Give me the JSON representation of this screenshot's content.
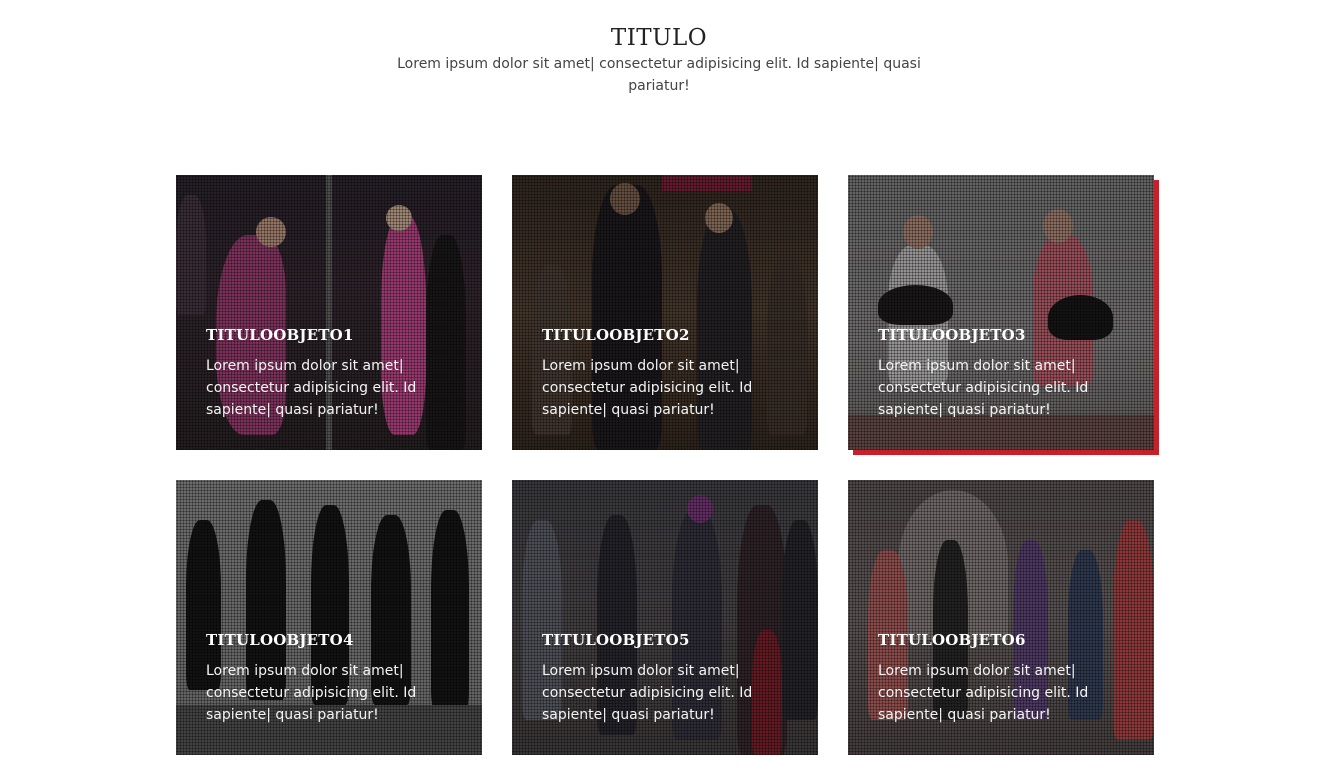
{
  "header": {
    "title": "TITULO",
    "subtitle": "Lorem ipsum dolor sit amet| consectetur adipisicing elit. Id sapiente| quasi pariatur!"
  },
  "cards": [
    {
      "title": "TITULOOBJETO1",
      "desc": "Lorem ipsum dolor sit amet| consectetur adipisicing elit. Id sapiente| quasi pariatur!",
      "image": "ballroom-dance-photo"
    },
    {
      "title": "TITULOOBJETO2",
      "desc": "Lorem ipsum dolor sit amet| consectetur adipisicing elit. Id sapiente| quasi pariatur!",
      "image": "salsa-class-photo"
    },
    {
      "title": "TITULOOBJETO3",
      "desc": "Lorem ipsum dolor sit amet| consectetur adipisicing elit. Id sapiente| quasi pariatur!",
      "image": "jumping-dancers-photo"
    },
    {
      "title": "TITULOOBJETO4",
      "desc": "Lorem ipsum dolor sit amet| consectetur adipisicing elit. Id sapiente| quasi pariatur!",
      "image": "dancer-silhouettes-photo"
    },
    {
      "title": "TITULOOBJETO5",
      "desc": "Lorem ipsum dolor sit amet| consectetur adipisicing elit. Id sapiente| quasi pariatur!",
      "image": "group-dance-class-photo"
    },
    {
      "title": "TITULOOBJETO6",
      "desc": "Lorem ipsum dolor sit amet| consectetur adipisicing elit. Id sapiente| quasi pariatur!",
      "image": "studio-dance-class-photo"
    }
  ],
  "colors": {
    "accent": "#c8202a",
    "overlay": "#141414"
  }
}
